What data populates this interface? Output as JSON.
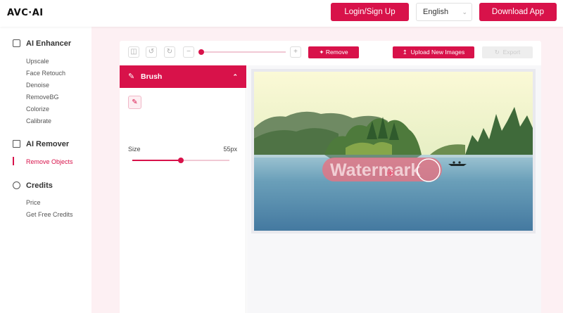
{
  "header": {
    "logo": "AVC·AI",
    "login_label": "Login/Sign Up",
    "language": "English",
    "download_label": "Download App"
  },
  "sidebar": {
    "sections": [
      {
        "title": "AI Enhancer",
        "icon": "image-icon",
        "items": [
          "Upscale",
          "Face Retouch",
          "Denoise",
          "RemoveBG",
          "Colorize",
          "Calibrate"
        ]
      },
      {
        "title": "AI Remover",
        "icon": "edit-icon",
        "items": [
          "Remove Objects"
        ]
      },
      {
        "title": "Credits",
        "icon": "credits-icon",
        "items": [
          "Price",
          "Get Free Credits"
        ]
      }
    ],
    "active_item": "Remove Objects"
  },
  "toolbar": {
    "remove_label": "Remove",
    "upload_label": "Upload New Images",
    "export_label": "Export"
  },
  "brush": {
    "title": "Brush",
    "size_label": "Size",
    "size_value": "55px",
    "size_fraction": 0.5
  },
  "canvas": {
    "watermark_text": "Watermark"
  },
  "colors": {
    "accent": "#d8124a",
    "page_bg": "#fdf0f3"
  }
}
